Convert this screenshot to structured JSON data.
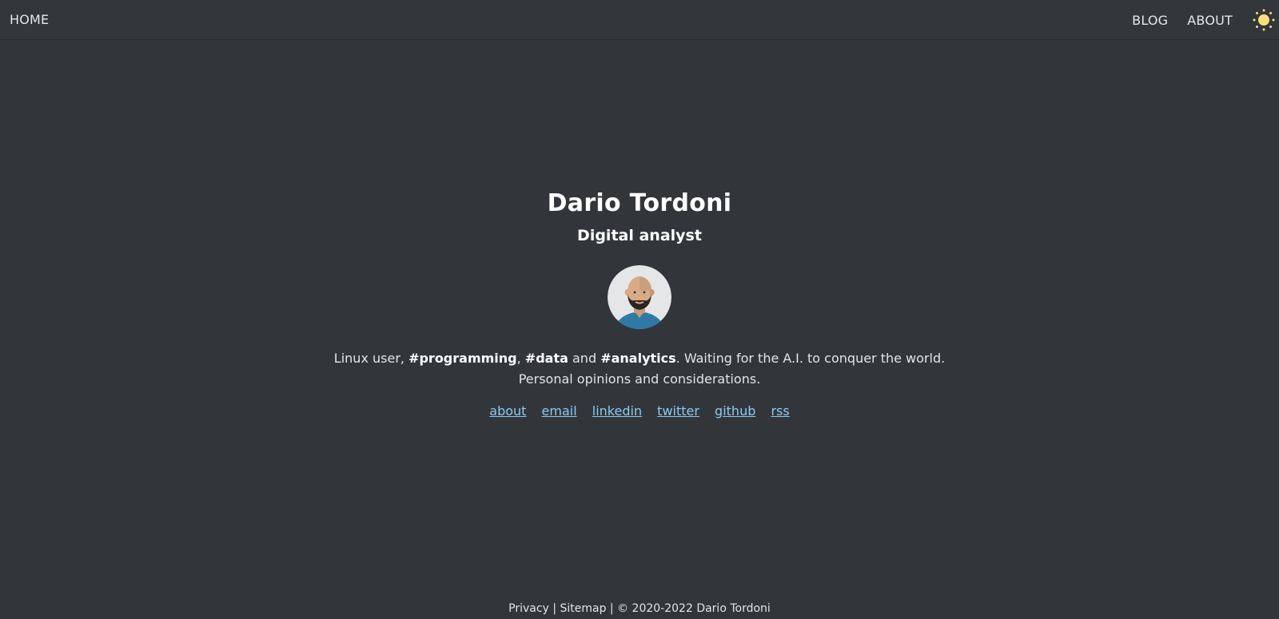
{
  "nav": {
    "home": "HOME",
    "blog": "BLOG",
    "about": "ABOUT",
    "theme_icon": "sun-icon",
    "theme_color": "#f9e079"
  },
  "profile": {
    "name": "Dario Tordoni",
    "subtitle": "Digital analyst",
    "avatar_icon": "avatar-bald-bearded-man"
  },
  "bio": {
    "intro": "Linux user, ",
    "tag1": "#programming",
    "sep1": ", ",
    "tag2": "#data",
    "sep2": " and ",
    "tag3": "#analytics",
    "rest": ". Waiting for the A.I. to conquer the world.",
    "line2": "Personal opinions and considerations."
  },
  "links": [
    "about",
    "email",
    "linkedin",
    "twitter",
    "github",
    "rss"
  ],
  "footer": {
    "privacy": "Privacy",
    "sep1": " | ",
    "sitemap": "Sitemap",
    "sep2": " | ",
    "copyright": "© 2020-2022 Dario Tordoni"
  },
  "colors": {
    "background": "#32363b",
    "link": "#8ec8f0",
    "heading": "#ffffff"
  }
}
